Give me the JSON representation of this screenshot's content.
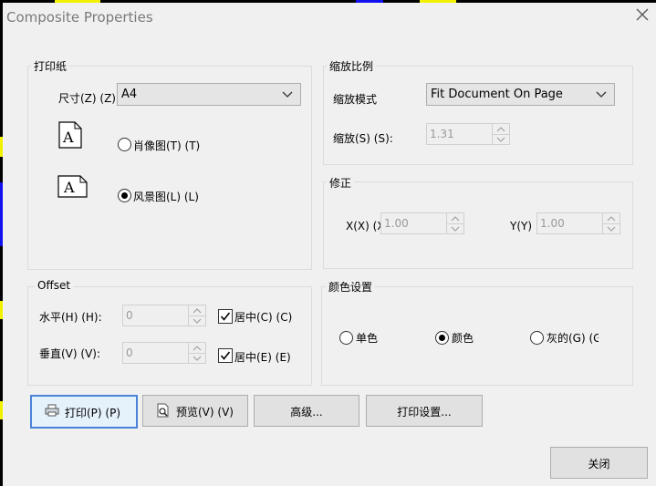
{
  "window": {
    "title": "Composite Properties"
  },
  "paper": {
    "legend": "打印纸",
    "size_label": "尺寸(Z) (Z)",
    "size_value": "A4",
    "portrait_label": "肖像图(T) (T)",
    "landscape_label": "风景图(L) (L)",
    "orientation_selected": "landscape"
  },
  "scale": {
    "legend": "缩放比例",
    "mode_label": "缩放模式",
    "mode_value": "Fit Document On Page",
    "scale_label": "缩放(S) (S):",
    "scale_value": "1.31"
  },
  "correction": {
    "legend": "修正",
    "x_label": "X(X) (X",
    "x_value": "1.00",
    "y_label": "Y(Y)",
    "y_value": "1.00"
  },
  "offset": {
    "legend": "Offset",
    "h_label": "水平(H) (H):",
    "h_value": "0",
    "h_center_label": "居中(C) (C)",
    "v_label": "垂直(V) (V):",
    "v_value": "0",
    "v_center_label": "居中(E) (E)",
    "h_center_checked": true,
    "v_center_checked": true
  },
  "color": {
    "legend": "颜色设置",
    "mono_label": "单色",
    "color_label": "颜色",
    "gray_label": "灰的(G) (G",
    "selected": "color"
  },
  "buttons": {
    "print": "打印(P) (P)",
    "preview": "预览(V) (V)",
    "advanced": "高级...",
    "print_setup": "打印设置...",
    "close": "关闭"
  },
  "icons": {
    "close": "close-icon",
    "portrait_page": "portrait-page-icon",
    "landscape_page": "landscape-page-icon",
    "printer": "printer-icon",
    "preview": "magnifier-page-icon",
    "chevron": "chevron-down-icon"
  }
}
